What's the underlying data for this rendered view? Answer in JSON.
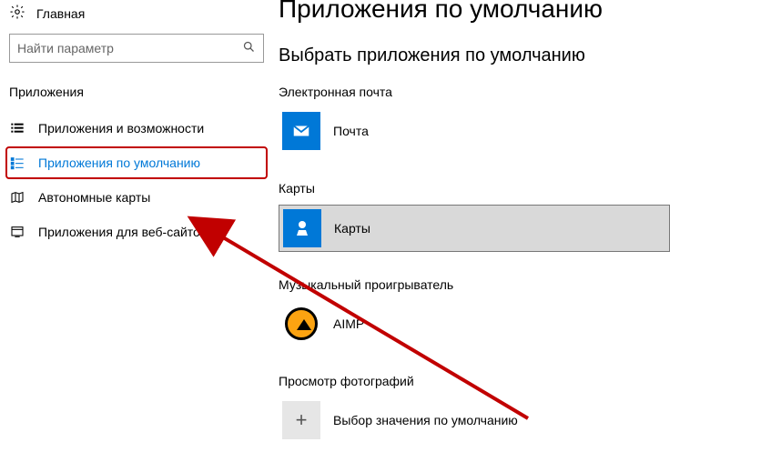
{
  "sidebar": {
    "home_label": "Главная",
    "search_placeholder": "Найти параметр",
    "section_title": "Приложения",
    "items": [
      {
        "label": "Приложения и возможности"
      },
      {
        "label": "Приложения по умолчанию"
      },
      {
        "label": "Автономные карты"
      },
      {
        "label": "Приложения для веб-сайтов"
      }
    ]
  },
  "main": {
    "page_title": "Приложения по умолчанию",
    "sub_title": "Выбрать приложения по умолчанию",
    "categories": [
      {
        "title": "Электронная почта",
        "app_label": "Почта"
      },
      {
        "title": "Карты",
        "app_label": "Карты"
      },
      {
        "title": "Музыкальный проигрыватель",
        "app_label": "AIMP"
      },
      {
        "title": "Просмотр фотографий",
        "app_label": "Выбор значения по умолчанию"
      }
    ]
  }
}
